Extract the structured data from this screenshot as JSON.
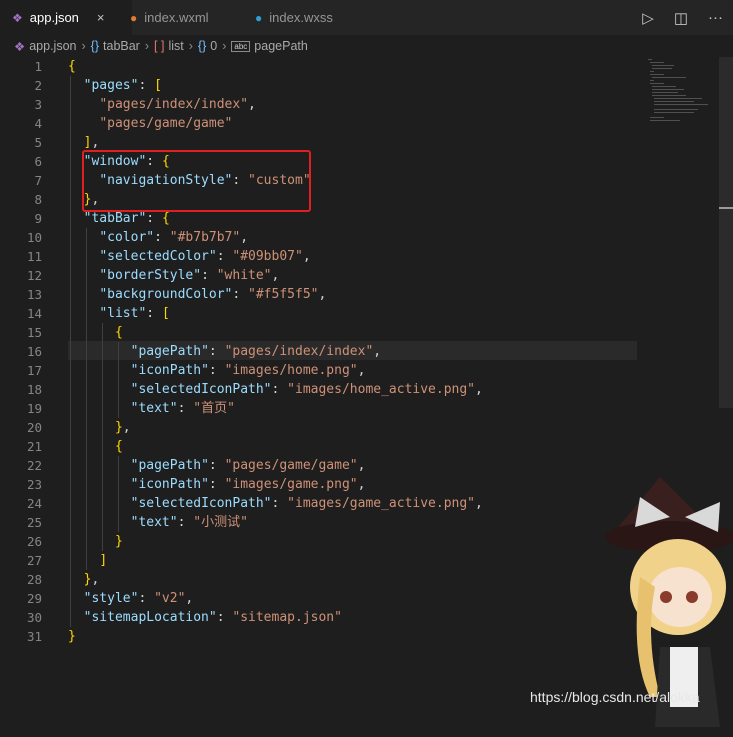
{
  "tabs": [
    {
      "label": "app.json",
      "icon": "json-icon",
      "active": true
    },
    {
      "label": "index.wxml",
      "icon": "wxml-icon",
      "active": false
    },
    {
      "label": "index.wxss",
      "icon": "wxss-icon",
      "active": false
    }
  ],
  "close_glyph": "×",
  "toolbar": {
    "run_icon": "play-icon",
    "split_icon": "split-editor-icon",
    "more_icon": "ellipsis-icon"
  },
  "breadcrumb": [
    {
      "icon": "",
      "label": "app.json"
    },
    {
      "icon": "{}",
      "label": "tabBar"
    },
    {
      "icon": "[ ]",
      "label": "list"
    },
    {
      "icon": "{}",
      "label": "0"
    },
    {
      "icon": "abc",
      "label": "pagePath"
    }
  ],
  "lines": [
    "{",
    "  \"pages\": [",
    "    \"pages/index/index\",",
    "    \"pages/game/game\"",
    "  ],",
    "  \"window\": {",
    "    \"navigationStyle\": \"custom\"",
    "  },",
    "  \"tabBar\": {",
    "    \"color\": \"#b7b7b7\",",
    "    \"selectedColor\": \"#09bb07\",",
    "    \"borderStyle\": \"white\",",
    "    \"backgroundColor\": \"#f5f5f5\",",
    "    \"list\": [",
    "      {",
    "        \"pagePath\": \"pages/index/index\",",
    "        \"iconPath\": \"images/home.png\",",
    "        \"selectedIconPath\": \"images/home_active.png\",",
    "        \"text\": \"首页\"",
    "      },",
    "      {",
    "        \"pagePath\": \"pages/game/game\",",
    "        \"iconPath\": \"images/game.png\",",
    "        \"selectedIconPath\": \"images/game_active.png\",",
    "        \"text\": \"小测试\"",
    "      }",
    "    ]",
    "  },",
    "  \"style\": \"v2\",",
    "  \"sitemapLocation\": \"sitemap.json\"",
    "}"
  ],
  "watermark": "https://blog.csdn.net/alokka",
  "colors": {
    "key": "#9cdcfe",
    "string": "#ce9178",
    "highlight_box": "#e02020",
    "background": "#1e1e1e"
  }
}
